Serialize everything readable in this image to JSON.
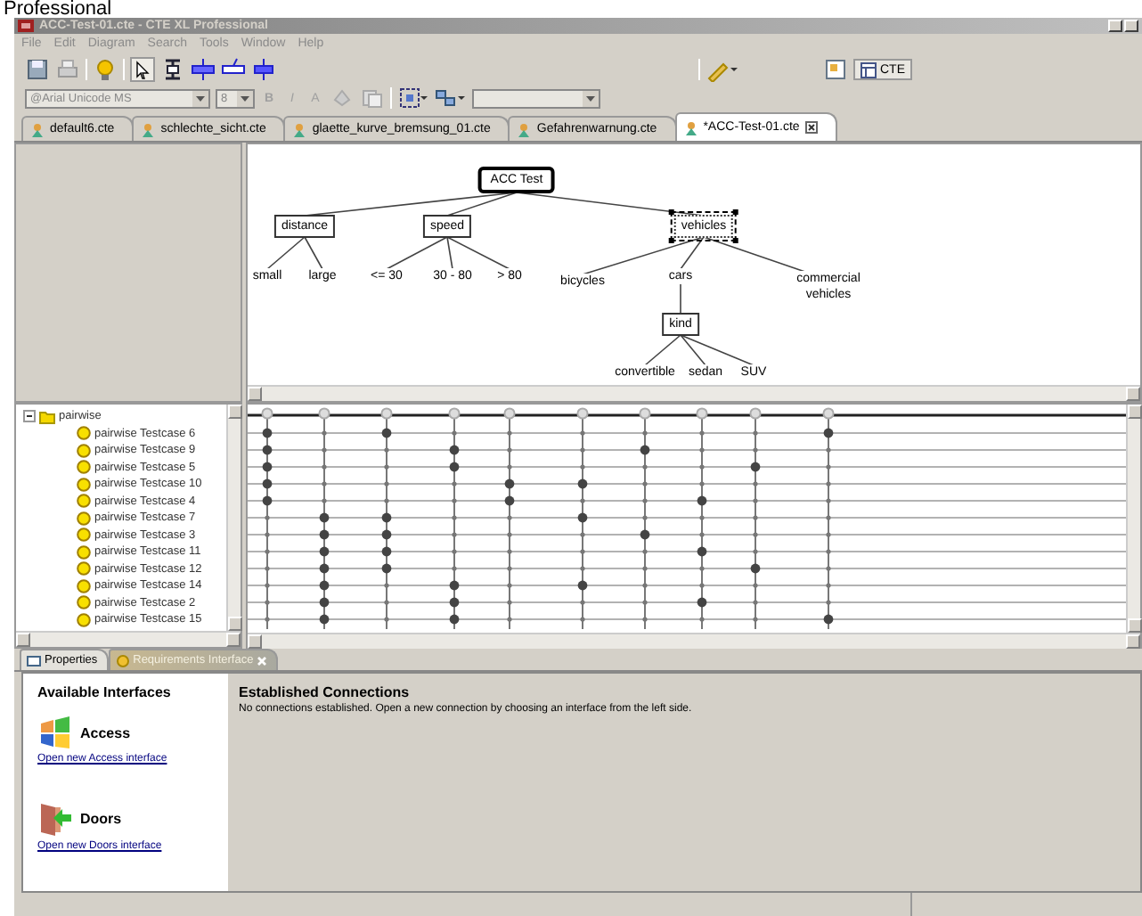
{
  "banner": {
    "text": "Professional"
  },
  "window": {
    "title": "ACC-Test-01.cte - CTE XL Professional"
  },
  "menu": [
    "File",
    "Edit",
    "Diagram",
    "Search",
    "Tools",
    "Window",
    "Help"
  ],
  "format_bar": {
    "font": "@Arial Unicode MS",
    "size": "8",
    "style_buttons": [
      {
        "label": "B",
        "disabled": true
      },
      {
        "label": "I",
        "disabled": true
      },
      {
        "label": "A",
        "disabled": true
      }
    ]
  },
  "perspective": {
    "label": "CTE",
    "selected": true
  },
  "tabs": [
    {
      "label": "default6.cte",
      "selected": false
    },
    {
      "label": "schlechte_sicht.cte",
      "selected": false
    },
    {
      "label": "glaette_kurve_bremsung_01.cte",
      "selected": false
    },
    {
      "label": "Gefahrenwarnung.cte",
      "selected": false
    },
    {
      "label": "*ACC-Test-01.cte",
      "selected": true
    }
  ],
  "tree": {
    "label": "ACC Test",
    "kind": "root",
    "selected": false,
    "children": [
      {
        "label": "distance",
        "kind": "classification",
        "selected": false,
        "children": [
          {
            "label": "small",
            "kind": "class"
          },
          {
            "label": "large",
            "kind": "class"
          }
        ]
      },
      {
        "label": "speed",
        "kind": "classification",
        "selected": false,
        "children": [
          {
            "label": "<= 30",
            "kind": "class"
          },
          {
            "label": "30 - 80",
            "kind": "class"
          },
          {
            "label": "> 80",
            "kind": "class"
          }
        ]
      },
      {
        "label": "vehicles",
        "kind": "classification",
        "selected": true,
        "children": [
          {
            "label": "bicycles",
            "kind": "class"
          },
          {
            "label": "cars",
            "kind": "class",
            "children": [
              {
                "label": "kind",
                "kind": "classification",
                "selected": false,
                "children": [
                  {
                    "label": "convertible",
                    "kind": "class"
                  },
                  {
                    "label": "sedan",
                    "kind": "class"
                  },
                  {
                    "label": "SUV",
                    "kind": "class"
                  }
                ]
              }
            ]
          },
          {
            "label": "commercial vehicles",
            "kind": "class"
          }
        ]
      }
    ]
  },
  "testcases": {
    "group": "pairwise",
    "expanded": true,
    "items": [
      {
        "label": "pairwise Testcase 6",
        "cells": [
          true,
          false,
          true,
          false,
          false,
          false,
          false,
          false,
          false,
          true
        ]
      },
      {
        "label": "pairwise Testcase 9",
        "cells": [
          true,
          false,
          false,
          true,
          false,
          false,
          true,
          false,
          false,
          false
        ]
      },
      {
        "label": "pairwise Testcase 5",
        "cells": [
          true,
          false,
          false,
          true,
          false,
          false,
          false,
          false,
          true,
          false
        ]
      },
      {
        "label": "pairwise Testcase 10",
        "cells": [
          true,
          false,
          false,
          false,
          true,
          true,
          false,
          false,
          false,
          false
        ]
      },
      {
        "label": "pairwise Testcase 4",
        "cells": [
          true,
          false,
          false,
          false,
          true,
          false,
          false,
          true,
          false,
          false
        ]
      },
      {
        "label": "pairwise Testcase 7",
        "cells": [
          false,
          true,
          true,
          false,
          false,
          true,
          false,
          false,
          false,
          false
        ]
      },
      {
        "label": "pairwise Testcase 3",
        "cells": [
          false,
          true,
          true,
          false,
          false,
          false,
          true,
          false,
          false,
          false
        ]
      },
      {
        "label": "pairwise Testcase 11",
        "cells": [
          false,
          true,
          true,
          false,
          false,
          false,
          false,
          true,
          false,
          false
        ]
      },
      {
        "label": "pairwise Testcase 12",
        "cells": [
          false,
          true,
          true,
          false,
          false,
          false,
          false,
          false,
          true,
          false
        ]
      },
      {
        "label": "pairwise Testcase 14",
        "cells": [
          false,
          true,
          false,
          true,
          false,
          true,
          false,
          false,
          false,
          false
        ]
      },
      {
        "label": "pairwise Testcase 2",
        "cells": [
          false,
          true,
          false,
          true,
          false,
          false,
          false,
          true,
          false,
          false
        ]
      },
      {
        "label": "pairwise Testcase 15",
        "cells": [
          false,
          true,
          false,
          true,
          false,
          false,
          false,
          false,
          false,
          true
        ]
      }
    ]
  },
  "bottom_tabs": [
    {
      "label": "Properties",
      "selected": false
    },
    {
      "label": "Requirements Interface",
      "selected": true
    }
  ],
  "interfaces": {
    "title": "Available Interfaces",
    "items": [
      {
        "name": "Access",
        "kind": "access",
        "link": "Open new Access interface"
      },
      {
        "name": "Doors",
        "kind": "doors",
        "link": "Open new Doors interface"
      }
    ]
  },
  "connections": {
    "title": "Established Connections",
    "message": "No connections established. Open a new connection by choosing an interface from the left side."
  }
}
